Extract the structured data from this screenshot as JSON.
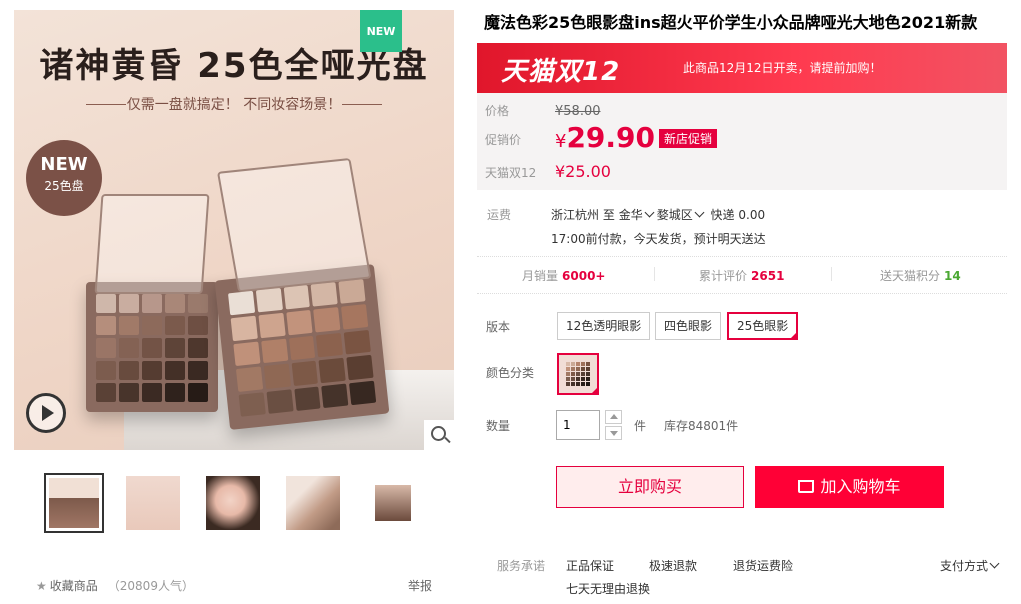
{
  "gallery": {
    "new_corner": "NEW",
    "image_title": "诸神黄昏 25色全哑光盘",
    "image_subtitle": "仅需一盘就搞定！ 不同妆容场景！",
    "badge_line1": "NEW",
    "badge_line2": "25色盘",
    "thumbnail_count": 5
  },
  "favorite": {
    "label": "收藏商品",
    "count": "（20809人气）"
  },
  "report_label": "举报",
  "product": {
    "title": "魔法色彩25色眼影盘ins超火平价学生小众品牌哑光大地色2021新款"
  },
  "promo_banner": {
    "logo": "天猫双12",
    "text": "此商品12月12日开卖，请提前加购！"
  },
  "price": {
    "original_label": "价格",
    "original": "¥58.00",
    "promo_label": "促销价",
    "promo_yen": "¥",
    "promo_value": "29.90",
    "promo_tag": "新店促销",
    "event_label": "天猫双12",
    "event_price": "¥25.00"
  },
  "shipping": {
    "label": "运费",
    "from": "浙江杭州",
    "to_word": "至",
    "city": "金华",
    "district": "婺城区",
    "method": "快递",
    "fee": "0.00",
    "note": "17:00前付款，今天发货，预计明天送达"
  },
  "stats": [
    {
      "label": "月销量",
      "value": "6000+"
    },
    {
      "label": "累计评价",
      "value": "2651"
    },
    {
      "label": "送天猫积分",
      "value": "14"
    }
  ],
  "version": {
    "label": "版本",
    "options": [
      "12色透明眼影",
      "四色眼影",
      "25色眼影"
    ],
    "selected": "25色眼影"
  },
  "color": {
    "label": "颜色分类"
  },
  "quantity": {
    "label": "数量",
    "value": "1",
    "unit": "件",
    "stock": "库存84801件"
  },
  "actions": {
    "buy": "立即购买",
    "cart": "加入购物车"
  },
  "service": {
    "label": "服务承诺",
    "items": [
      "正品保证",
      "极速退款",
      "退货运费险"
    ],
    "line2": "七天无理由退换",
    "payment": "支付方式"
  },
  "colors": {
    "accent": "#e5003e",
    "banner": "#e0162b",
    "green": "#4ba833"
  }
}
